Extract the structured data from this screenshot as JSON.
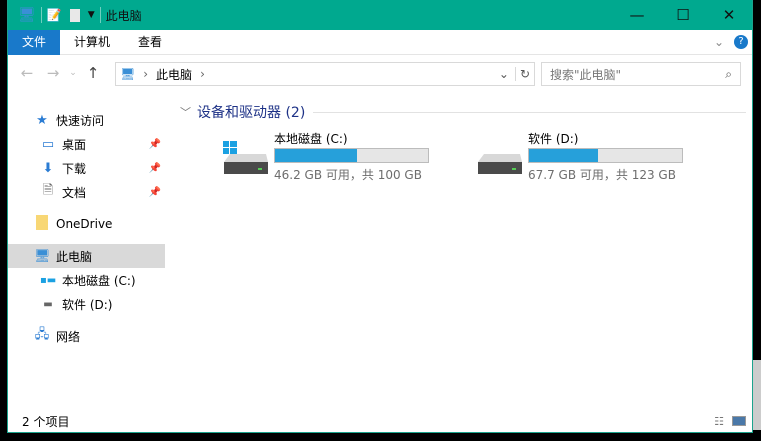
{
  "window": {
    "title": "此电脑",
    "minimize": "—",
    "maximize": "☐",
    "close": "✕"
  },
  "ribbon": {
    "tabs": [
      "文件",
      "计算机",
      "查看"
    ],
    "help": "?"
  },
  "address": {
    "path": [
      "此电脑"
    ],
    "search_placeholder": "搜索\"此电脑\""
  },
  "nav": {
    "quick_access": "快速访问",
    "items": [
      "桌面",
      "下载",
      "文档"
    ],
    "onedrive": "OneDrive",
    "this_pc": "此电脑",
    "drives": [
      "本地磁盘 (C:)",
      "软件 (D:)"
    ],
    "network": "网络"
  },
  "content": {
    "group_title": "设备和驱动器 (2)",
    "drives": [
      {
        "name": "本地磁盘 (C:)",
        "info": "46.2 GB 可用，共 100 GB",
        "used_fraction": 0.538
      },
      {
        "name": "软件 (D:)",
        "info": "67.7 GB 可用，共 123 GB",
        "used_fraction": 0.45
      }
    ]
  },
  "status": {
    "count": "2 个项目"
  },
  "colors": {
    "title_bar": "#00a98f",
    "accent": "#1979ca",
    "bar_fill": "#26a0da"
  }
}
